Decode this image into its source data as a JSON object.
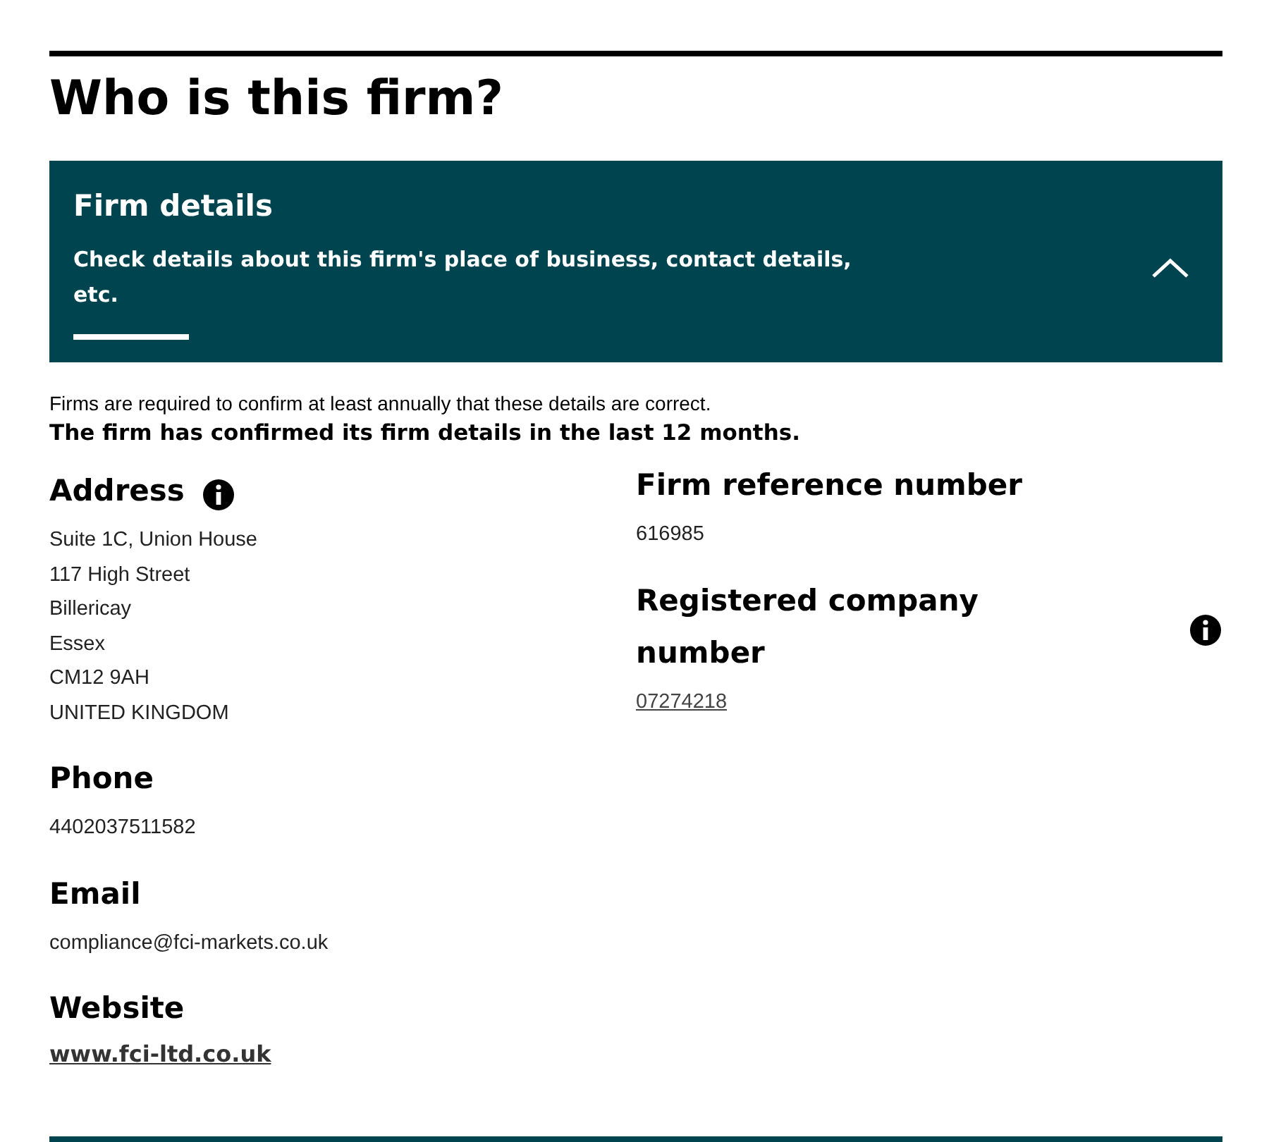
{
  "heading": "Who is this firm?",
  "panel": {
    "title": "Firm details",
    "description": "Check details about this firm's place of business, contact details, etc.",
    "expanded": true
  },
  "notice": "Firms are required to confirm at least annually that these details are correct.",
  "confirmation": "The firm has confirmed its firm details in the last 12 months.",
  "left_fields": [
    {
      "label": "Address",
      "info": true,
      "kind": "text",
      "lines": [
        "Suite 1C, Union House",
        "117 High Street",
        "Billericay",
        "Essex",
        "CM12 9AH",
        "UNITED KINGDOM"
      ]
    },
    {
      "label": "Phone",
      "info": false,
      "kind": "text",
      "lines": [
        "4402037511582"
      ]
    },
    {
      "label": "Email",
      "info": false,
      "kind": "text",
      "lines": [
        "compliance@fci-markets.co.uk"
      ]
    },
    {
      "label": "Website",
      "info": false,
      "kind": "weblink",
      "lines": [
        "www.fci-ltd.co.uk"
      ]
    }
  ],
  "right_fields": [
    {
      "label": "Firm reference number",
      "info": false,
      "kind": "text",
      "lines": [
        "616985"
      ]
    },
    {
      "label": "Registered company number",
      "info": true,
      "kind": "link",
      "lines": [
        "07274218"
      ]
    }
  ]
}
